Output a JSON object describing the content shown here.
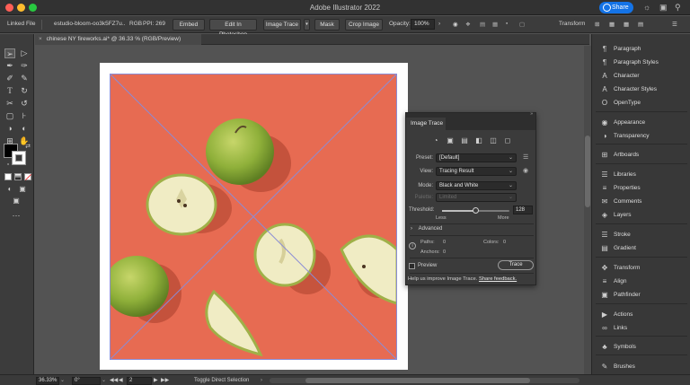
{
  "app": {
    "title": "Adobe Illustrator 2022",
    "share_label": "Share",
    "accent": "#1473e6"
  },
  "controlbar": {
    "linked_file": "Linked File",
    "filename": "estudio-bloom-oo3k5FZ7u...",
    "color_mode": "RGB",
    "ppi": "PPI: 269",
    "embed": "Embed",
    "edit_in_photoshop": "Edit In Photoshop",
    "image_trace": "Image Trace",
    "mask": "Mask",
    "crop_image": "Crop Image",
    "opacity_label": "Opacity:",
    "opacity_value": "100%",
    "transform": "Transform"
  },
  "document": {
    "tab_title": "chinese NY fireworks.ai* @ 36.33 % (RGB/Preview)",
    "art_bg": "#e76b52"
  },
  "right_panels": [
    {
      "label": "Paragraph",
      "icon": "paragraph-icon"
    },
    {
      "label": "Paragraph Styles",
      "icon": "paragraph-styles-icon"
    },
    {
      "label": "Character",
      "icon": "character-icon"
    },
    {
      "label": "Character Styles",
      "icon": "character-styles-icon"
    },
    {
      "label": "OpenType",
      "icon": "opentype-icon"
    },
    {
      "label": "Appearance",
      "icon": "appearance-icon"
    },
    {
      "label": "Transparency",
      "icon": "transparency-icon"
    },
    {
      "label": "Artboards",
      "icon": "artboards-icon"
    },
    {
      "label": "Libraries",
      "icon": "libraries-icon"
    },
    {
      "label": "Properties",
      "icon": "properties-icon"
    },
    {
      "label": "Comments",
      "icon": "comments-icon"
    },
    {
      "label": "Layers",
      "icon": "layers-icon"
    },
    {
      "label": "Stroke",
      "icon": "stroke-icon"
    },
    {
      "label": "Gradient",
      "icon": "gradient-icon"
    },
    {
      "label": "Transform",
      "icon": "transform-icon"
    },
    {
      "label": "Align",
      "icon": "align-icon"
    },
    {
      "label": "Pathfinder",
      "icon": "pathfinder-icon"
    },
    {
      "label": "Actions",
      "icon": "actions-icon"
    },
    {
      "label": "Links",
      "icon": "links-icon"
    },
    {
      "label": "Symbols",
      "icon": "symbols-icon"
    },
    {
      "label": "Brushes",
      "icon": "brushes-icon"
    }
  ],
  "image_trace": {
    "title": "Image Trace",
    "preset_label": "Preset:",
    "preset_value": "[Default]",
    "view_label": "View:",
    "view_value": "Tracing Result",
    "mode_label": "Mode:",
    "mode_value": "Black and White",
    "palette_label": "Palette:",
    "palette_value": "Limited",
    "threshold_label": "Threshold:",
    "threshold_value": "128",
    "threshold_fraction": 0.5,
    "less": "Less",
    "more": "More",
    "advanced": "Advanced",
    "paths_label": "Paths:",
    "paths_value": "0",
    "colors_label": "Colors:",
    "colors_value": "0",
    "anchors_label": "Anchors:",
    "anchors_value": "0",
    "preview_label": "Preview",
    "trace_label": "Trace",
    "footer_text": "Help us improve Image Trace.",
    "footer_link": "Share feedback."
  },
  "status": {
    "zoom": "36.33%",
    "rotation": "0°",
    "artboard": "2",
    "tool_hint": "Toggle Direct Selection"
  }
}
